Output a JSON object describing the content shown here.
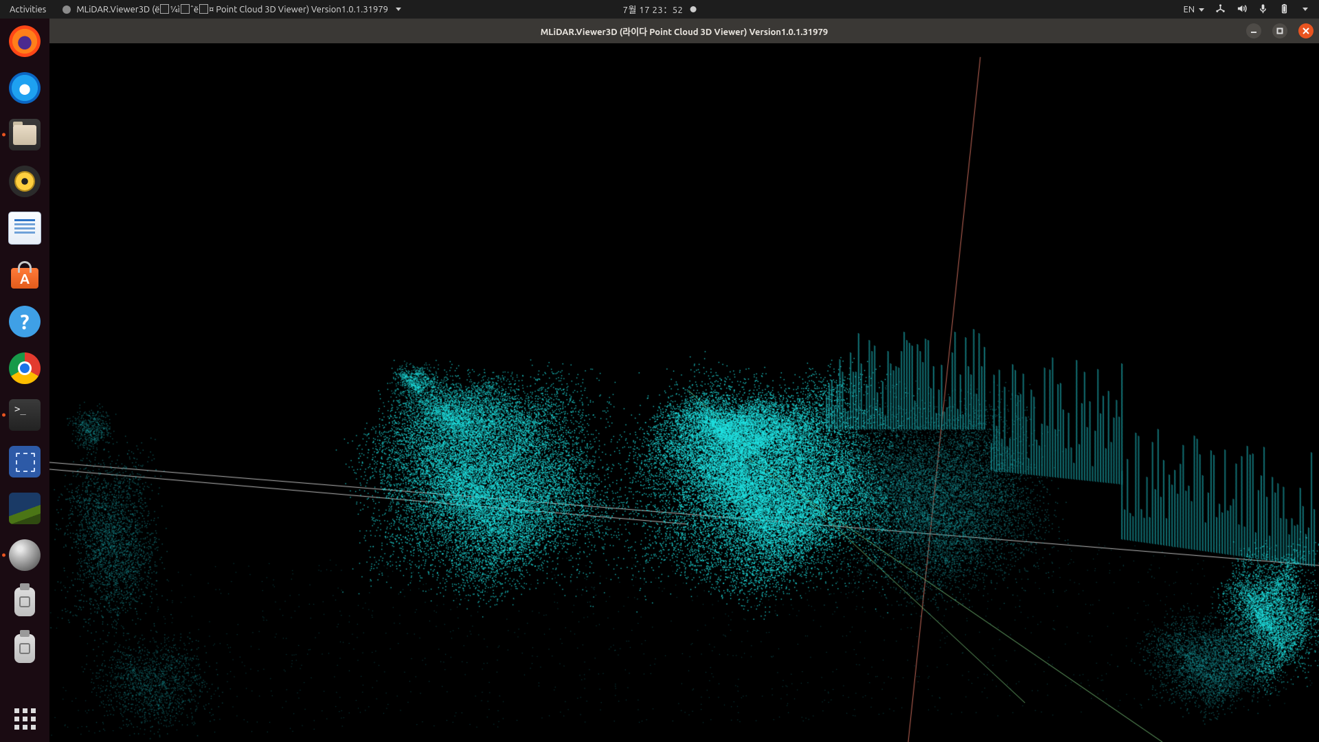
{
  "topbar": {
    "activities": "Activities",
    "app_menu_label": "MLiDAR.Viewer3D (ë  ¼ì  ˆë  ¤ Point Cloud 3D Viewer) Version1.0.1.31979",
    "clock": "7월 17  23：52",
    "lang": "EN"
  },
  "dock": {
    "items": [
      {
        "name": "firefox"
      },
      {
        "name": "thunderbird"
      },
      {
        "name": "files"
      },
      {
        "name": "rhythmbox"
      },
      {
        "name": "libreoffice-writer"
      },
      {
        "name": "ubuntu-software"
      },
      {
        "name": "help"
      },
      {
        "name": "google-chrome"
      },
      {
        "name": "terminal"
      },
      {
        "name": "screenshot"
      },
      {
        "name": "image-viewer"
      },
      {
        "name": "mlidar-viewer3d"
      },
      {
        "name": "usb-drive-1"
      },
      {
        "name": "usb-drive-2"
      }
    ]
  },
  "window": {
    "title": "MLiDAR.Viewer3D (라이다 Point Cloud 3D Viewer) Version1.0.1.31979"
  },
  "viewport": {
    "point_color": "#20e4e4",
    "point_color_dim": "#1a9da2",
    "axis_colors": {
      "x": "#c86b5b",
      "y": "#6fb36f",
      "z": "#c86b5b"
    },
    "grid_color": "#c8c8c8"
  }
}
